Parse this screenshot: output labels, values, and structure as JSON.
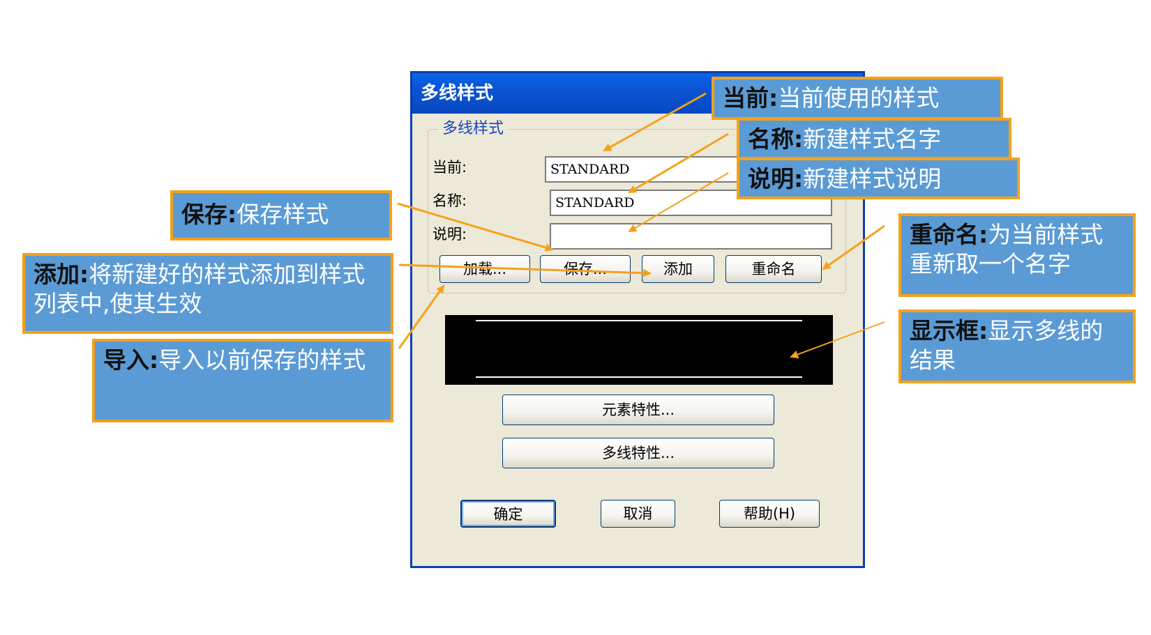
{
  "dialog": {
    "title": "多线样式",
    "group_title": "多线样式",
    "labels": {
      "current": "当前:",
      "name": "名称:",
      "description": "说明:"
    },
    "fields": {
      "current_value": "STANDARD",
      "name_value": "STANDARD",
      "description_value": ""
    },
    "buttons": {
      "load": "加载...",
      "save": "保存...",
      "add": "添加",
      "rename": "重命名",
      "element_properties": "元素特性...",
      "multiline_properties": "多线特性...",
      "ok": "确定",
      "cancel": "取消",
      "help": "帮助(H)"
    }
  },
  "callouts": {
    "current": {
      "term": "当前:",
      "desc": "当前使用的样式"
    },
    "name": {
      "term": "名称:",
      "desc": "新建样式名字"
    },
    "description": {
      "term": "说明:",
      "desc": "新建样式说明"
    },
    "save": {
      "term": "保存:",
      "desc": "保存样式"
    },
    "add": {
      "term": "添加:",
      "desc": "将新建好的样式添加到样式列表中,使其生效"
    },
    "import": {
      "term": "导入:",
      "desc": "导入以前保存的样式"
    },
    "rename": {
      "term": "重命名:",
      "desc": "为当前样式重新取一个名字"
    },
    "display": {
      "term": "显示框:",
      "desc": "显示多线的结果"
    }
  },
  "colors": {
    "callout_fill": "#5b9bd5",
    "callout_border": "#f5a11a",
    "arrow": "#f5a11a",
    "titlebar": "#0a54d3"
  }
}
